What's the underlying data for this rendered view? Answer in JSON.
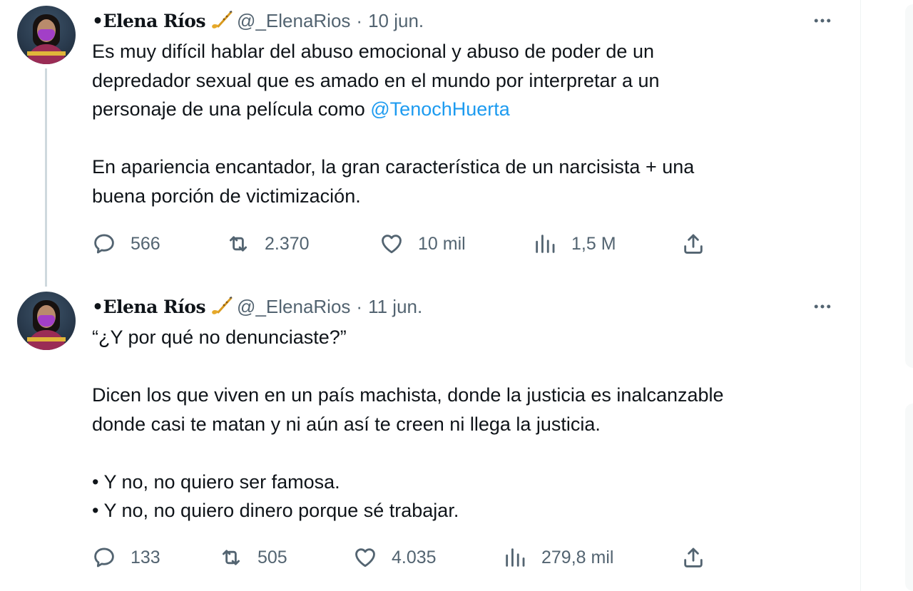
{
  "tweets": [
    {
      "author_name": "•Elena Ríos",
      "handle": "@_ElenaRios",
      "separator": "·",
      "date": "10 jun.",
      "text_lines": [
        "Es muy difícil hablar del abuso emocional y abuso de poder de un",
        "depredador sexual que es amado en el mundo por interpretar a un"
      ],
      "text_line3_prefix": "personaje de una película como ",
      "mention": "@TenochHuerta",
      "text_para2": [
        "En apariencia encantador, la gran característica de un narcisista + una",
        "buena porción de victimización."
      ],
      "stats": {
        "replies": "566",
        "retweets": "2.370",
        "likes": "10 mil",
        "views": "1,5 M"
      }
    },
    {
      "author_name": "•Elena Ríos",
      "handle": "@_ElenaRios",
      "separator": "·",
      "date": "11 jun.",
      "text_para1": "“¿Y por qué no denunciaste?”",
      "text_para2": [
        "Dicen los que viven en un país machista, donde la justicia es inalcanzable",
        "donde casi te matan y ni aún así te creen ni llega la justicia."
      ],
      "text_para3": [
        "• Y no, no quiero ser famosa.",
        "• Y no, no quiero dinero porque sé trabajar."
      ],
      "stats": {
        "replies": "133",
        "retweets": "505",
        "likes": "4.035",
        "views": "279,8 mil"
      }
    }
  ],
  "colors": {
    "text": "#0f1419",
    "muted": "#536471",
    "link": "#1d9bf0",
    "thread_line": "#cfd9de",
    "mask": "#a23fc7"
  },
  "icons": [
    "more-icon",
    "reply-icon",
    "retweet-icon",
    "like-icon",
    "views-icon",
    "share-icon",
    "saxophone-emoji-icon"
  ]
}
